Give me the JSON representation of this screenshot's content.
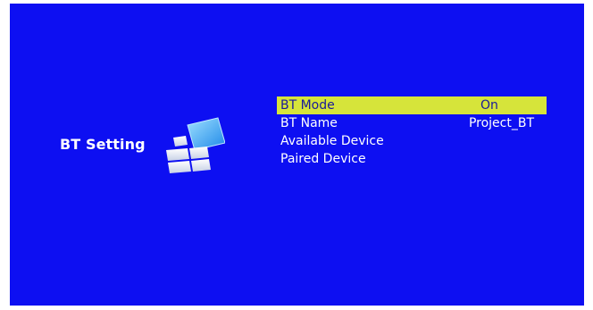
{
  "panel": {
    "title": "BT Setting",
    "icon": "settings-tiles-icon"
  },
  "menu": {
    "items": [
      {
        "label": "BT Mode",
        "value": "On",
        "selected": true
      },
      {
        "label": "BT Name",
        "value": "Project_BT",
        "selected": false
      },
      {
        "label": "Available Device",
        "value": "",
        "selected": false
      },
      {
        "label": "Paired Device",
        "value": "",
        "selected": false
      }
    ]
  },
  "colors": {
    "background": "#0d0ff2",
    "highlight": "#d6e43a",
    "highlight_text": "#1a1a9a",
    "text": "#ffffff"
  }
}
